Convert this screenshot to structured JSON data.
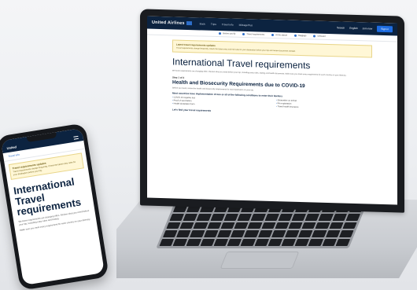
{
  "site": {
    "logo": "United Airlines",
    "nav": [
      "Book",
      "Trips",
      "Travel info",
      "MileagePlus"
    ],
    "header_right": [
      "Search",
      "English"
    ],
    "join_label": "Join now",
    "signin_label": "Sign in",
    "subnav": [
      "Before you fly",
      "Travel requirements",
      "At the airport",
      "Baggage",
      "Onboard"
    ]
  },
  "laptop_page": {
    "alert_title": "Latest travel requirements updates",
    "alert_text": "Travel requirements change frequently. Check the latest entry and exit rules for your destination before your trip and review documents needed.",
    "title": "International Travel requirements",
    "intro": "We know requirements are changing often. Review what you need before your trip, including entry rules, testing and health documents. Make sure you meet every requirement for each country on your itinerary.",
    "step_label": "Step 1 of 3",
    "section_title": "Health and Biosecurity Requirements due to COVID-19",
    "section_text": "Before you travel, review the health and biosecurity requirements for each destination on your trip.",
    "list_heading": "Most countries have implementation of one or all of the following conditions to enter their borders",
    "requirements": [
      "COVID-19 negative test",
      "Proof of vaccination",
      "Health declaration form",
      "Travel health insurance",
      "Quarantine on arrival",
      "Pre-registration"
    ],
    "more_heading": "Let's find your travel requirements"
  },
  "phone_page": {
    "logo": "United",
    "breadcrumb": "Travel info",
    "alert_title": "Travel requirements updates",
    "alert_text": "Travel requirements change frequently. Check the latest entry rules for your destination before your trip.",
    "title": "International Travel requirements",
    "text_1": "We know requirements are changing often. Review what you need before your trip, including entry rules and testing.",
    "text_2": "Make sure you meet every requirement for each country on your itinerary."
  },
  "colors": {
    "brand_navy": "#0c2340",
    "brand_blue": "#1e6ce0",
    "alert_bg": "#fff7d6"
  }
}
